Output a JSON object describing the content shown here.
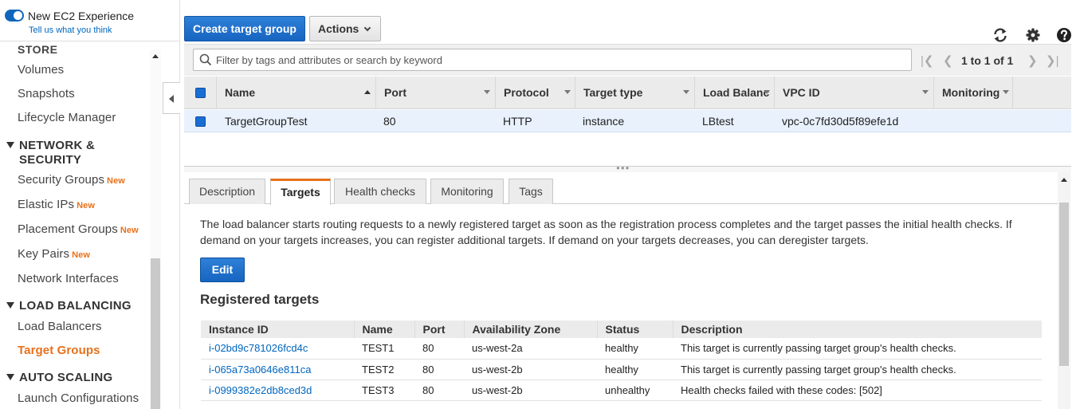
{
  "experience": {
    "toggle_label": "New EC2 Experience",
    "feedback_link": "Tell us what you think"
  },
  "sidebar": {
    "cut_heading": "STORE",
    "items_top": [
      {
        "label": "Volumes"
      },
      {
        "label": "Snapshots"
      },
      {
        "label": "Lifecycle Manager"
      }
    ],
    "network_heading_line1": "NETWORK &",
    "network_heading_line2": "SECURITY",
    "network_items": [
      {
        "label": "Security Groups",
        "badge": "New"
      },
      {
        "label": "Elastic IPs",
        "badge": "New"
      },
      {
        "label": "Placement Groups",
        "badge": "New"
      },
      {
        "label": "Key Pairs",
        "badge": "New"
      },
      {
        "label": "Network Interfaces",
        "badge": ""
      }
    ],
    "lb_heading": "LOAD BALANCING",
    "lb_items": [
      {
        "label": "Load Balancers"
      },
      {
        "label": "Target Groups",
        "active": true
      }
    ],
    "as_heading": "AUTO SCALING",
    "as_items": [
      {
        "label": "Launch Configurations"
      }
    ]
  },
  "toolbar": {
    "create_label": "Create target group",
    "actions_label": "Actions",
    "icons": [
      "refresh-icon",
      "gear-icon",
      "help-icon"
    ]
  },
  "filter": {
    "placeholder": "Filter by tags and attributes or search by keyword",
    "pagination": "1 to 1 of 1"
  },
  "grid": {
    "columns": [
      "Name",
      "Port",
      "Protocol",
      "Target type",
      "Load Balanc",
      "VPC ID",
      "Monitoring"
    ],
    "rows": [
      {
        "name": "TargetGroupTest",
        "port": "80",
        "protocol": "HTTP",
        "target_type": "instance",
        "load_balancer": "LBtest",
        "vpc_id": "vpc-0c7fd30d5f89efe1d",
        "monitoring": ""
      }
    ]
  },
  "detail": {
    "tabs": [
      "Description",
      "Targets",
      "Health checks",
      "Monitoring",
      "Tags"
    ],
    "active_tab": "Targets",
    "description": "The load balancer starts routing requests to a newly registered target as soon as the registration process completes and the target passes the initial health checks. If demand on your targets increases, you can register additional targets. If demand on your targets decreases, you can deregister targets.",
    "edit_label": "Edit",
    "registered_title": "Registered targets",
    "table": {
      "headers": [
        "Instance ID",
        "Name",
        "Port",
        "Availability Zone",
        "Status",
        "Description"
      ],
      "rows": [
        [
          "i-02bd9c781026fcd4c",
          "TEST1",
          "80",
          "us-west-2a",
          "healthy",
          "This target is currently passing target group's health checks."
        ],
        [
          "i-065a73a0646e811ca",
          "TEST2",
          "80",
          "us-west-2b",
          "healthy",
          "This target is currently passing target group's health checks."
        ],
        [
          "i-0999382e2db8ced3d",
          "TEST3",
          "80",
          "us-west-2b",
          "unhealthy",
          "Health checks failed with these codes: [502]"
        ]
      ]
    }
  },
  "colors": {
    "primary_button": "#1a6dd3",
    "active_accent": "#e7711b",
    "link": "#0066c0",
    "selected_row": "#e8f1fc"
  }
}
